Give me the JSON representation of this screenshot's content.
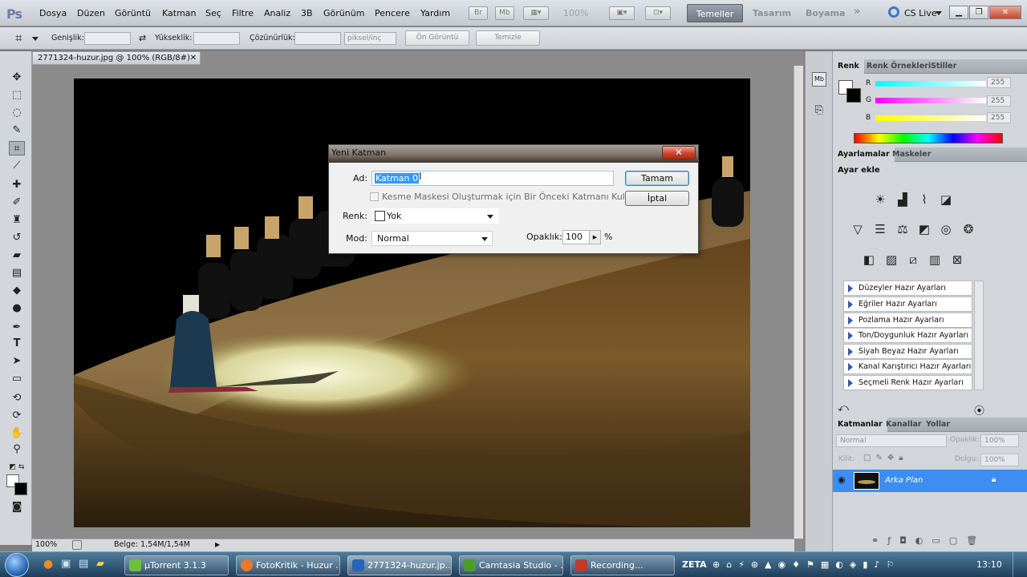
{
  "app": {
    "logo": "Ps"
  },
  "menu": [
    "Dosya",
    "Düzen",
    "Görüntü",
    "Katman",
    "Seç",
    "Filtre",
    "Analiz",
    "3B",
    "Görünüm",
    "Pencere",
    "Yardım"
  ],
  "appbar": {
    "zoom": "100%"
  },
  "workspaces": {
    "active": "Temeller",
    "others": [
      "Tasarım",
      "Boyama"
    ],
    "more": "»",
    "cslive": "CS Live"
  },
  "options": {
    "width_label": "Genişlik:",
    "height_label": "Yükseklik:",
    "resolution_label": "Çözünürlük:",
    "resolution_unit": "piksel/inç",
    "front_image": "Ön Görüntü",
    "clear": "Temizle"
  },
  "document": {
    "tab_title": "2771324-huzur.jpg @ 100% (RGB/8#)",
    "zoom": "100%",
    "doc_size": "Belge: 1,54M/1,54M"
  },
  "color_panel": {
    "tabs": [
      "Renk",
      "Renk Örnekleri",
      "Stiller"
    ],
    "channels": [
      {
        "name": "R",
        "value": "255"
      },
      {
        "name": "G",
        "value": "255"
      },
      {
        "name": "B",
        "value": "255"
      }
    ]
  },
  "adjustments_panel": {
    "tabs": [
      "Ayarlamalar",
      "Maskeler"
    ],
    "heading": "Ayar ekle",
    "presets": [
      "Düzeyler Hazır Ayarları",
      "Eğriler Hazır Ayarları",
      "Pozlama Hazır Ayarları",
      "Ton/Doygunluk Hazır Ayarları",
      "Siyah Beyaz Hazır Ayarları",
      "Kanal Karıştırıcı Hazır Ayarları",
      "Seçmeli Renk Hazır Ayarları"
    ]
  },
  "layers_panel": {
    "tabs": [
      "Katmanlar",
      "Kanallar",
      "Yollar"
    ],
    "blend_mode": "Normal",
    "opacity_label": "Opaklık:",
    "opacity": "100%",
    "lock_label": "Kilit:",
    "fill_label": "Dolgu:",
    "fill": "100%",
    "layer_name": "Arka Plan"
  },
  "dialog": {
    "title": "Yeni Katman",
    "name_label": "Ad:",
    "name_value": "Katman 0",
    "clip_label": "Kesme Maskesi Oluşturmak için Bir Önceki Katmanı Kullan",
    "color_label": "Renk:",
    "color_value": "Yok",
    "mode_label": "Mod:",
    "mode_value": "Normal",
    "opacity_label": "Opaklık:",
    "opacity_value": "100",
    "opacity_unit": "%",
    "ok": "Tamam",
    "cancel": "İptal"
  },
  "taskbar": {
    "tasks": [
      {
        "label": "µTorrent 3.1.3",
        "color": "#6fbf3a"
      },
      {
        "label": "FotoKritik - Huzur ...",
        "color": "#e8782c"
      },
      {
        "label": "2771324-huzur.jp...",
        "color": "#2a64b8"
      },
      {
        "label": "Camtasia Studio - ...",
        "color": "#4f9a2e"
      },
      {
        "label": "Recording...",
        "color": "#c0392b"
      }
    ],
    "tray_label": "ZETA",
    "clock": "13:10"
  }
}
